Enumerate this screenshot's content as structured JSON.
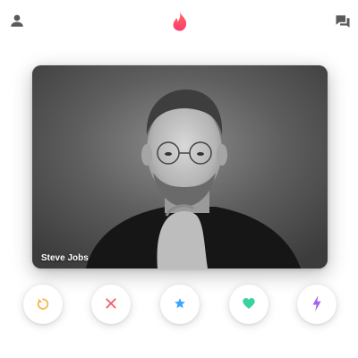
{
  "header": {
    "left_icon": "profile-icon",
    "center_icon": "flame-icon",
    "right_icon": "messages-icon"
  },
  "card": {
    "name": "Steve Jobs",
    "photo": "portrait-photo"
  },
  "actions": [
    {
      "icon": "rewind-icon",
      "color": "#f5b748"
    },
    {
      "icon": "close-icon",
      "color": "#f05a6b"
    },
    {
      "icon": "star-icon",
      "color": "#3ca4ff"
    },
    {
      "icon": "heart-icon",
      "color": "#3bd1a0"
    },
    {
      "icon": "bolt-icon",
      "color": "#a35ff1"
    }
  ],
  "colors": {
    "brand": "#fe3c72",
    "icon_gray": "#5a5a5a"
  }
}
